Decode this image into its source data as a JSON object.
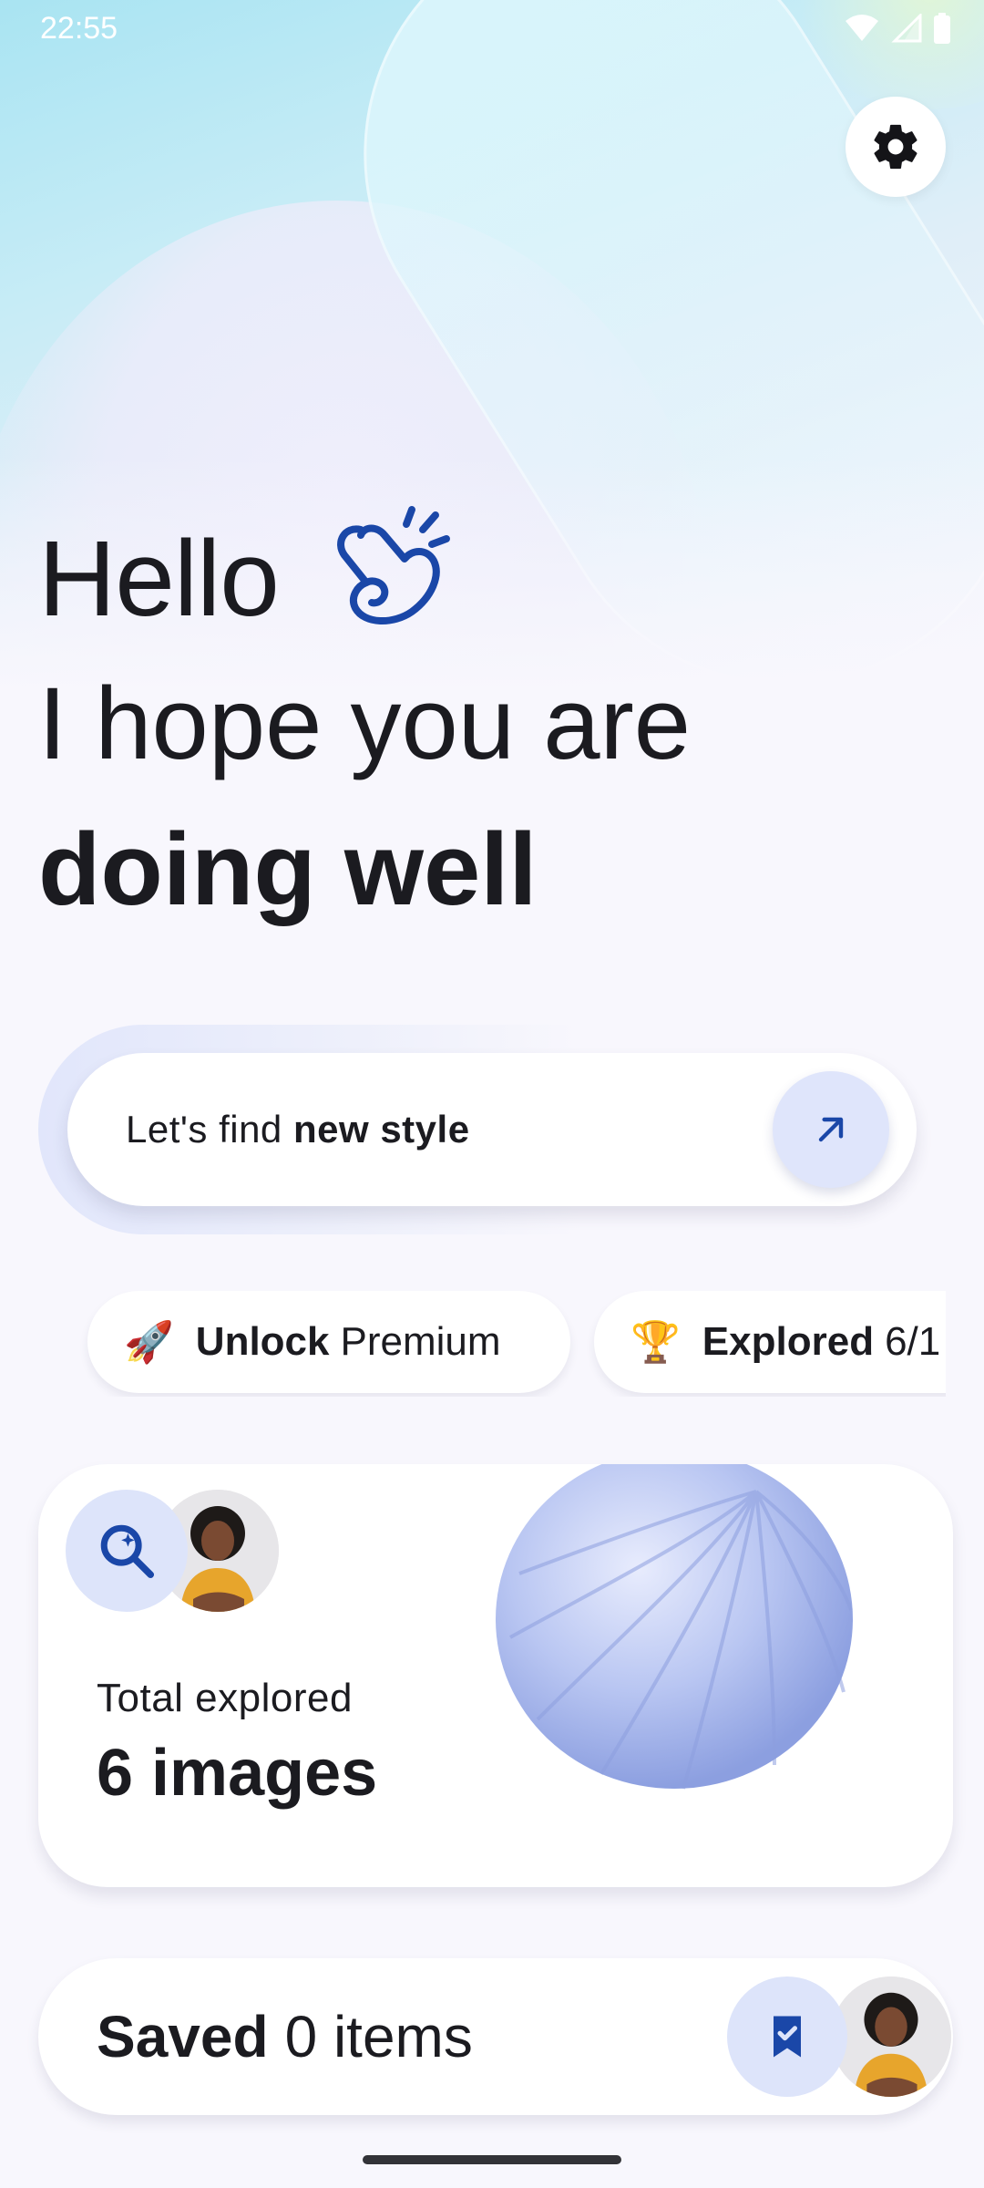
{
  "status_bar": {
    "time": "22:55"
  },
  "settings": {
    "icon": "gear-icon"
  },
  "greeting": {
    "line1": "Hello",
    "line2": "I hope you are",
    "line3": "doing well",
    "icon": "waving-hand-icon"
  },
  "search": {
    "prefix": "Let's find ",
    "emphasis": "new style",
    "button_icon": "arrow-up-right-icon"
  },
  "chips": [
    {
      "emoji": "🚀",
      "bold": "Unlock",
      "text": "Premium"
    },
    {
      "emoji": "🏆",
      "bold": "Explored",
      "text": "6/1"
    }
  ],
  "explore_card": {
    "label": "Total explored",
    "value": "6 images",
    "icon": "sparkle-search-icon"
  },
  "saved_card": {
    "bold": "Saved",
    "text": "0 items",
    "icon": "bookmark-check-icon"
  },
  "colors": {
    "accent": "#1a47a8",
    "accent_soft": "#dde4fa",
    "background": "#f8f7fd",
    "text": "#1b1b20"
  }
}
